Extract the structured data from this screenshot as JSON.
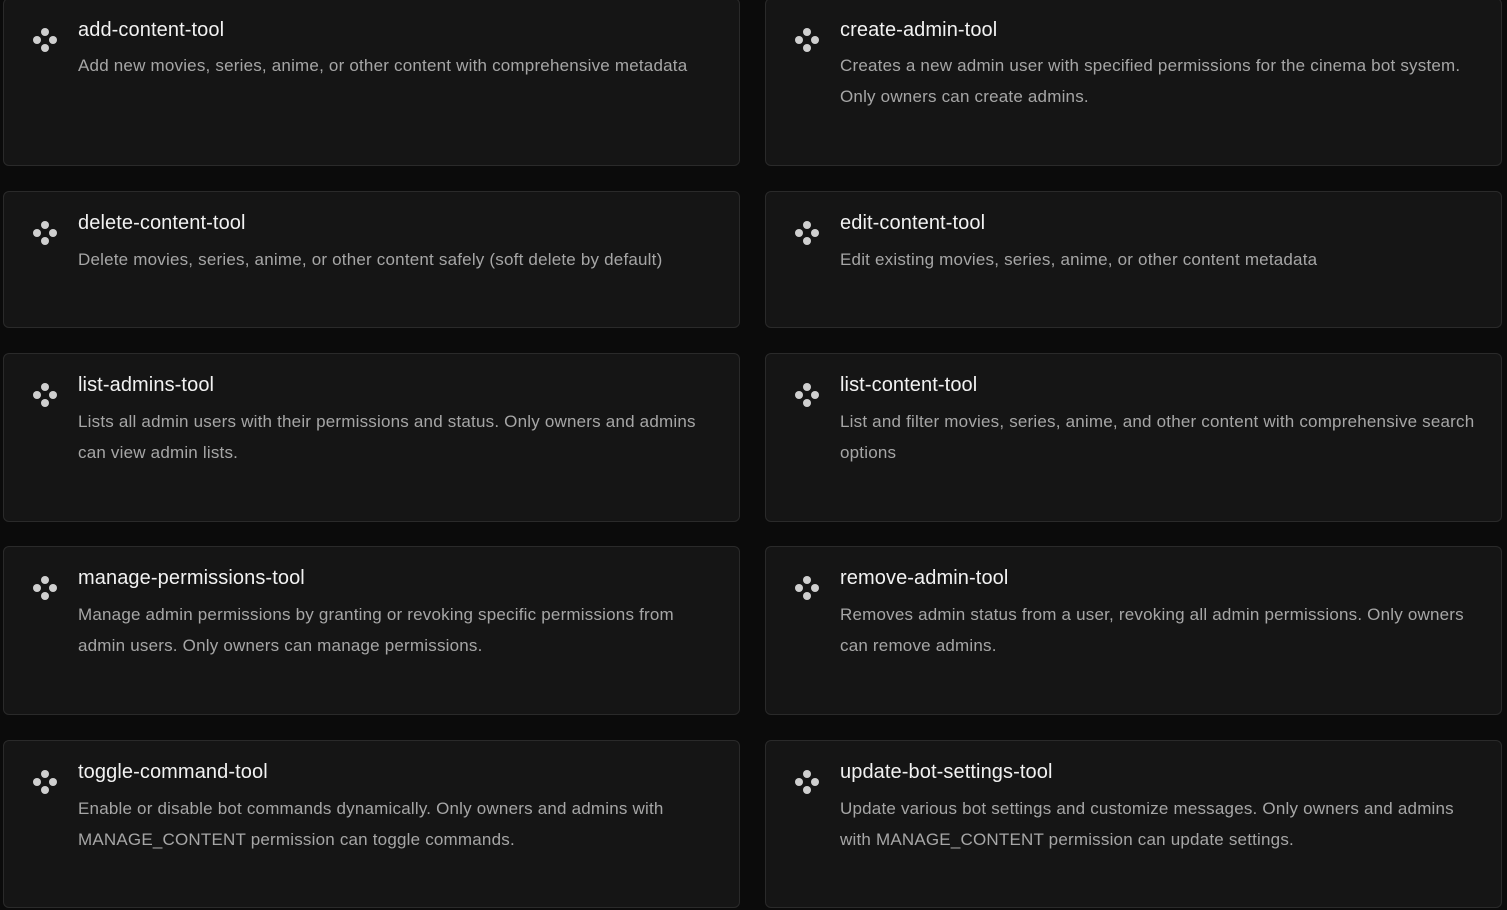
{
  "tools": [
    {
      "name": "add-content-tool",
      "description": "Add new movies, series, anime, or other content with comprehensive metadata",
      "icon": "tool-icon"
    },
    {
      "name": "create-admin-tool",
      "description": "Creates a new admin user with specified permissions for the cinema bot system. Only owners can create admins.",
      "icon": "tool-icon"
    },
    {
      "name": "delete-content-tool",
      "description": "Delete movies, series, anime, or other content safely (soft delete by default)",
      "icon": "tool-icon"
    },
    {
      "name": "edit-content-tool",
      "description": "Edit existing movies, series, anime, or other content metadata",
      "icon": "tool-icon"
    },
    {
      "name": "list-admins-tool",
      "description": "Lists all admin users with their permissions and status. Only owners and admins can view admin lists.",
      "icon": "tool-icon"
    },
    {
      "name": "list-content-tool",
      "description": "List and filter movies, series, anime, and other content with comprehensive search options",
      "icon": "tool-icon"
    },
    {
      "name": "manage-permissions-tool",
      "description": "Manage admin permissions by granting or revoking specific permissions from admin users. Only owners can manage permissions.",
      "icon": "tool-icon"
    },
    {
      "name": "remove-admin-tool",
      "description": "Removes admin status from a user, revoking all admin permissions. Only owners can remove admins.",
      "icon": "tool-icon"
    },
    {
      "name": "toggle-command-tool",
      "description": "Enable or disable bot commands dynamically. Only owners and admins with MANAGE_CONTENT permission can toggle commands.",
      "icon": "tool-icon"
    },
    {
      "name": "update-bot-settings-tool",
      "description": "Update various bot settings and customize messages. Only owners and admins with MANAGE_CONTENT permission can update settings.",
      "icon": "tool-icon"
    }
  ],
  "colors": {
    "background": "#0b0b0b",
    "card": "#151515",
    "border": "#2a2a2a",
    "title": "#f2f2f2",
    "description": "#a6a6a6",
    "icon": "#cfcfcf"
  }
}
